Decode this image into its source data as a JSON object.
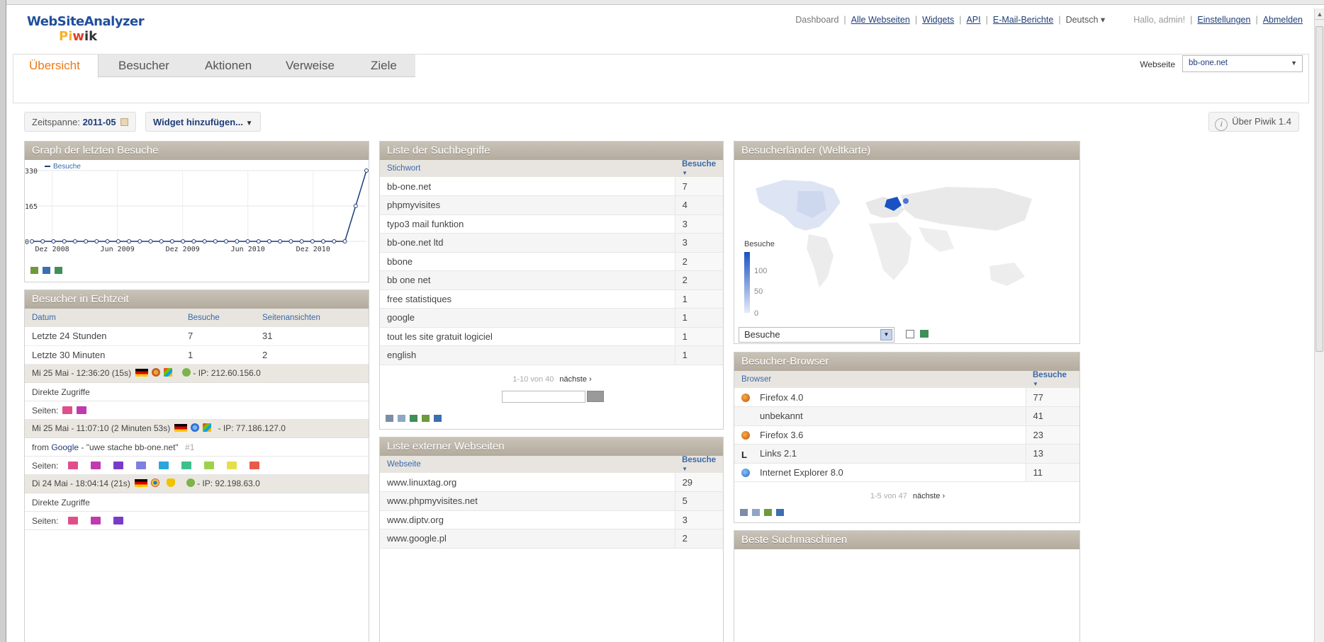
{
  "logo": {
    "line1": "WebSiteAnalyzer",
    "line2_pi": "Pi",
    "line2_w": "w",
    "line2_ik": "ik"
  },
  "topmenu": {
    "dashboard": "Dashboard",
    "all_sites": "Alle Webseiten",
    "widgets": "Widgets",
    "api": "API",
    "email_reports": "E-Mail-Berichte",
    "language": "Deutsch",
    "hello": "Hallo, admin!",
    "settings": "Einstellungen",
    "logout": "Abmelden"
  },
  "tabs": [
    {
      "label": "Übersicht"
    },
    {
      "label": "Besucher"
    },
    {
      "label": "Aktionen"
    },
    {
      "label": "Verweise"
    },
    {
      "label": "Ziele"
    }
  ],
  "website_selector": {
    "label": "Webseite",
    "value": "bb-one.net"
  },
  "toolbar": {
    "period_label": "Zeitspanne:",
    "period_value": "2011-05",
    "add_widget": "Widget hinzufügen...",
    "about": "Über Piwik 1.4"
  },
  "widget_graph": {
    "title": "Graph der letzten Besuche",
    "chart_data": {
      "type": "line",
      "series": [
        {
          "name": "Besuche",
          "values": [
            0,
            0,
            0,
            0,
            0,
            0,
            0,
            0,
            0,
            0,
            0,
            0,
            0,
            0,
            0,
            0,
            0,
            0,
            0,
            0,
            0,
            0,
            0,
            0,
            0,
            0,
            0,
            0,
            0,
            0,
            165,
            330
          ]
        }
      ],
      "yticks": [
        "0",
        "165",
        "330"
      ],
      "ylim": [
        0,
        330
      ],
      "xticks": [
        "Dez 2008",
        "Jun 2009",
        "Dez 2009",
        "Jun 2010",
        "Dez 2010"
      ]
    }
  },
  "widget_realtime": {
    "title": "Besucher in Echtzeit",
    "columns": [
      "Datum",
      "Besuche",
      "Seitenansichten"
    ],
    "rows": [
      {
        "label": "Letzte 24 Stunden",
        "visits": "7",
        "pageviews": "31"
      },
      {
        "label": "Letzte 30 Minuten",
        "visits": "1",
        "pageviews": "2"
      }
    ],
    "visits": [
      {
        "time": "Mi 25 Mai - 12:36:20 (15s)",
        "ip": "- IP: 212.60.156.0",
        "ref": "Direkte Zugriffe",
        "pages_label": "Seiten:"
      },
      {
        "time": "Mi 25 Mai - 11:07:10 (2 Minuten 53s)",
        "ip": "- IP: 77.186.127.0",
        "ref_prefix": "from",
        "ref_link": "Google",
        "ref_query": "- \"uwe stache bb-one.net\"",
        "ref_rank": "#1",
        "pages_label": "Seiten:"
      },
      {
        "time": "Di 24 Mai - 18:04:14 (21s)",
        "ip": "- IP: 92.198.63.0",
        "ref": "Direkte Zugriffe",
        "pages_label": "Seiten:"
      }
    ]
  },
  "widget_keywords": {
    "title": "Liste der Suchbegriffe",
    "col_label": "Stichwort",
    "col_value": "Besuche",
    "rows": [
      {
        "label": "bb-one.net",
        "value": "7"
      },
      {
        "label": "phpmyvisites",
        "value": "4"
      },
      {
        "label": "typo3 mail funktion",
        "value": "3"
      },
      {
        "label": "bb-one.net ltd",
        "value": "3"
      },
      {
        "label": "bbone",
        "value": "2"
      },
      {
        "label": "bb one net",
        "value": "2"
      },
      {
        "label": "free statistiques",
        "value": "1"
      },
      {
        "label": "google",
        "value": "1"
      },
      {
        "label": "tout les site gratuit logiciel",
        "value": "1"
      },
      {
        "label": "english",
        "value": "1"
      }
    ],
    "pager": "1-10 von 40",
    "next": "nächste ›"
  },
  "widget_websites": {
    "title": "Liste externer Webseiten",
    "col_label": "Webseite",
    "col_value": "Besuche",
    "rows": [
      {
        "label": "www.linuxtag.org",
        "value": "29"
      },
      {
        "label": "www.phpmyvisites.net",
        "value": "5"
      },
      {
        "label": "www.diptv.org",
        "value": "3"
      },
      {
        "label": "www.google.pl",
        "value": "2"
      }
    ]
  },
  "widget_map": {
    "title": "Besucherländer (Weltkarte)",
    "legend_title": "Besuche",
    "legend_ticks": [
      "100",
      "50",
      "0"
    ],
    "select_value": "Besuche"
  },
  "widget_browser": {
    "title": "Besucher-Browser",
    "col_label": "Browser",
    "col_value": "Besuche",
    "rows": [
      {
        "label": "Firefox 4.0",
        "value": "77",
        "icon": "firefox-icon"
      },
      {
        "label": "unbekannt",
        "value": "41",
        "icon": ""
      },
      {
        "label": "Firefox 3.6",
        "value": "23",
        "icon": "firefox-icon"
      },
      {
        "label": "Links 2.1",
        "value": "13",
        "icon": "links-icon"
      },
      {
        "label": "Internet Explorer 8.0",
        "value": "11",
        "icon": "ie-icon"
      }
    ],
    "pager": "1-5 von 47",
    "next": "nächste ›"
  },
  "widget_search_engines": {
    "title": "Beste Suchmaschinen"
  },
  "colors": {
    "accent_orange": "#ee7a15",
    "link_blue": "#1f3d78",
    "widget_header": "#b9b1a4",
    "map_high": "#1a52c4",
    "map_low": "#dde4f3"
  }
}
